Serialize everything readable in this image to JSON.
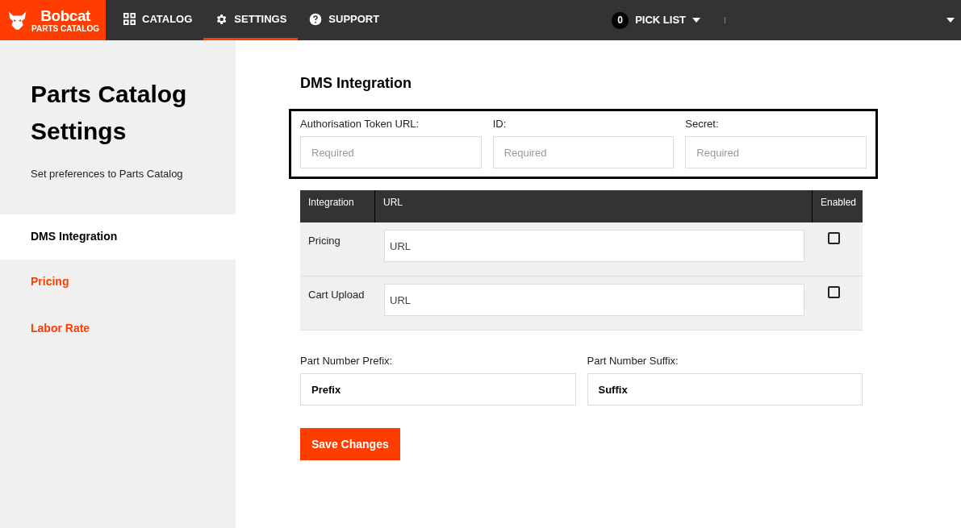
{
  "header": {
    "logo": {
      "brand": "Bobcat",
      "subtitle": "PARTS CATALOG"
    },
    "nav": [
      {
        "label": "CATALOG",
        "kind": "grid",
        "selected": false
      },
      {
        "label": "SETTINGS",
        "kind": "gear",
        "selected": true
      },
      {
        "label": "SUPPORT",
        "kind": "help",
        "selected": false
      }
    ],
    "pick_list": {
      "count": "0",
      "label": "PICK LIST"
    }
  },
  "sidebar": {
    "title": "Parts Catalog Settings",
    "subtitle": "Set preferences to Parts Catalog",
    "items": [
      {
        "label": "DMS Integration",
        "selected": true
      },
      {
        "label": "Pricing",
        "selected": false
      },
      {
        "label": "Labor Rate",
        "selected": false
      }
    ]
  },
  "main": {
    "heading": "DMS Integration",
    "credentials": [
      {
        "label": "Authorisation Token URL:",
        "placeholder": "Required"
      },
      {
        "label": "ID:",
        "placeholder": "Required"
      },
      {
        "label": "Secret:",
        "placeholder": "Required"
      }
    ],
    "table": {
      "columns": [
        "Integration",
        "URL",
        "Enabled"
      ],
      "rows": [
        {
          "name": "Pricing",
          "placeholder": "URL",
          "checked": false
        },
        {
          "name": "Cart Upload",
          "placeholder": "URL",
          "checked": false
        }
      ]
    },
    "part_number": [
      {
        "label": "Part Number Prefix:",
        "placeholder": "Prefix"
      },
      {
        "label": "Part Number Suffix:",
        "placeholder": "Suffix"
      }
    ],
    "save_button": "Save Changes"
  }
}
